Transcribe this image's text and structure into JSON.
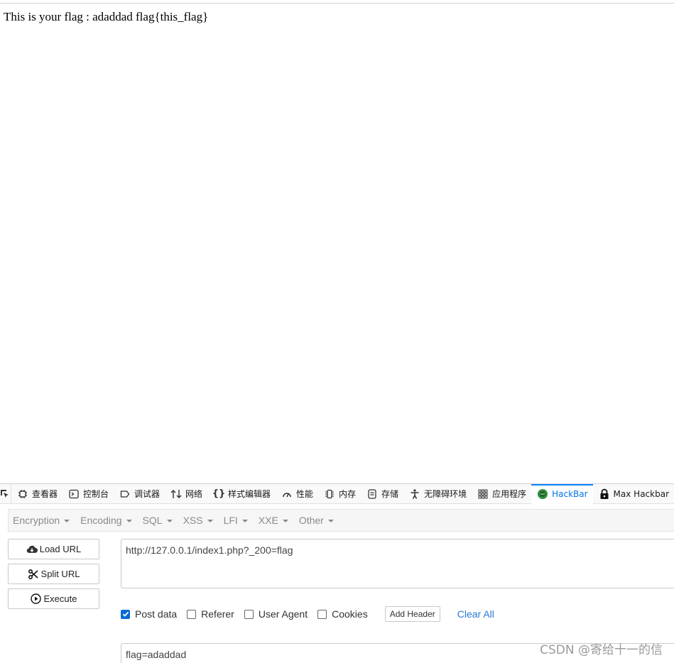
{
  "page": {
    "body_text": "This is your flag : adaddad flag{this_flag}"
  },
  "devtools": {
    "tabs": [
      {
        "label": "查看器",
        "icon": "inspector-icon"
      },
      {
        "label": "控制台",
        "icon": "console-icon"
      },
      {
        "label": "调试器",
        "icon": "debugger-icon"
      },
      {
        "label": "网络",
        "icon": "network-icon"
      },
      {
        "label": "样式编辑器",
        "icon": "style-editor-icon"
      },
      {
        "label": "性能",
        "icon": "performance-icon"
      },
      {
        "label": "内存",
        "icon": "memory-icon"
      },
      {
        "label": "存储",
        "icon": "storage-icon"
      },
      {
        "label": "无障碍环境",
        "icon": "accessibility-icon"
      },
      {
        "label": "应用程序",
        "icon": "application-icon"
      },
      {
        "label": "HackBar",
        "icon": "hackbar-icon",
        "active": true
      },
      {
        "label": "Max Hackbar",
        "icon": "lock-icon"
      }
    ],
    "active_color": "#0074e8"
  },
  "hackbar": {
    "menu": [
      "Encryption",
      "Encoding",
      "SQL",
      "XSS",
      "LFI",
      "XXE",
      "Other"
    ],
    "buttons": {
      "load_url": "Load URL",
      "split_url": "Split URL",
      "execute": "Execute"
    },
    "url_value": "http://127.0.0.1/index1.php?_200=flag",
    "options": {
      "post_data": {
        "label": "Post data",
        "checked": true
      },
      "referer": {
        "label": "Referer",
        "checked": false
      },
      "user_agent": {
        "label": "User Agent",
        "checked": false
      },
      "cookies": {
        "label": "Cookies",
        "checked": false
      }
    },
    "add_header": "Add Header",
    "clear_all": "Clear All",
    "post_value": "flag=adaddad"
  },
  "watermark": "CSDN @寄给十一的信"
}
